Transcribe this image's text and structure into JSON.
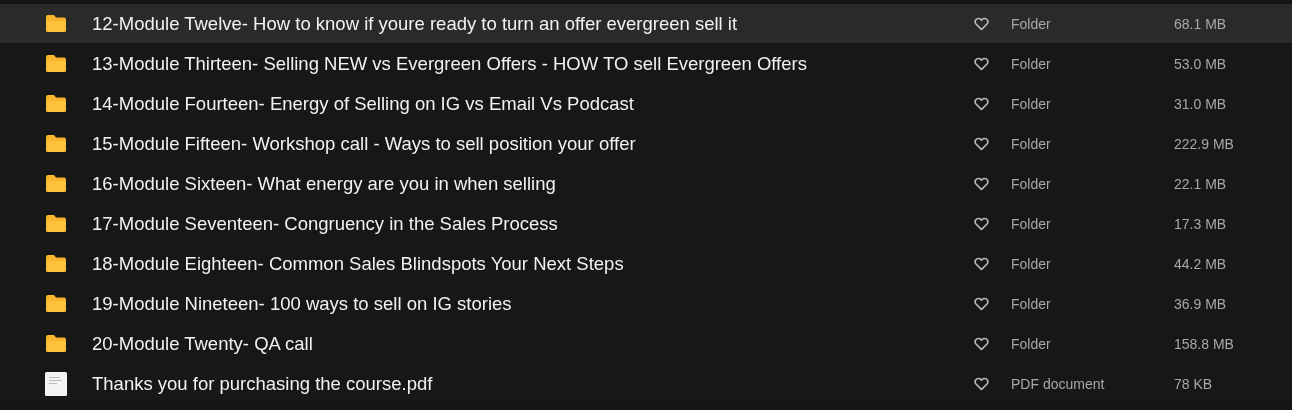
{
  "files": [
    {
      "kind": "folder",
      "name": "12-Module Twelve- How to know if youre ready to turn an offer evergreen sell it",
      "type": "Folder",
      "size": "68.1 MB",
      "highlighted": true
    },
    {
      "kind": "folder",
      "name": "13-Module Thirteen- Selling NEW vs Evergreen Offers - HOW TO sell Evergreen Offers",
      "type": "Folder",
      "size": "53.0 MB",
      "highlighted": false
    },
    {
      "kind": "folder",
      "name": "14-Module Fourteen- Energy of Selling on IG vs Email Vs Podcast",
      "type": "Folder",
      "size": "31.0 MB",
      "highlighted": false
    },
    {
      "kind": "folder",
      "name": "15-Module Fifteen- Workshop call - Ways to sell position your offer",
      "type": "Folder",
      "size": "222.9 MB",
      "highlighted": false
    },
    {
      "kind": "folder",
      "name": "16-Module Sixteen- What energy are you in when selling",
      "type": "Folder",
      "size": "22.1 MB",
      "highlighted": false
    },
    {
      "kind": "folder",
      "name": "17-Module Seventeen- Congruency in the Sales Process",
      "type": "Folder",
      "size": "17.3 MB",
      "highlighted": false
    },
    {
      "kind": "folder",
      "name": "18-Module Eighteen- Common Sales Blindspots Your Next Steps",
      "type": "Folder",
      "size": "44.2 MB",
      "highlighted": false
    },
    {
      "kind": "folder",
      "name": "19-Module Nineteen- 100 ways to sell on IG stories",
      "type": "Folder",
      "size": "36.9 MB",
      "highlighted": false
    },
    {
      "kind": "folder",
      "name": "20-Module Twenty- QA call",
      "type": "Folder",
      "size": "158.8 MB",
      "highlighted": false
    },
    {
      "kind": "document",
      "name": "Thanks you for purchasing the course.pdf",
      "type": "PDF document",
      "size": "78 KB",
      "highlighted": false
    }
  ]
}
